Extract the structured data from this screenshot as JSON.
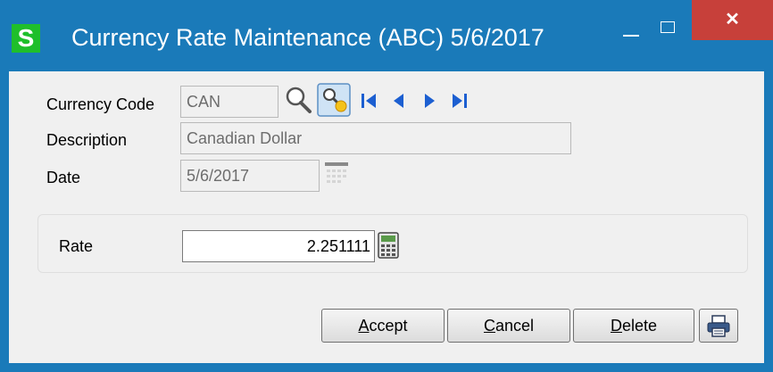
{
  "window": {
    "title": "Currency Rate Maintenance (ABC) 5/6/2017",
    "logo_letter": "S",
    "close_glyph": "✕"
  },
  "form": {
    "currency_code_label": "Currency Code",
    "currency_code_value": "CAN",
    "description_label": "Description",
    "description_value": "Canadian Dollar",
    "date_label": "Date",
    "date_value": "5/6/2017",
    "rate_label": "Rate",
    "rate_value": "2.251111"
  },
  "buttons": {
    "accept_mnemonic": "A",
    "accept_rest": "ccept",
    "cancel_mnemonic": "C",
    "cancel_rest": "ancel",
    "delete_mnemonic": "D",
    "delete_rest": "elete"
  },
  "icons": {
    "lookup": "magnifier-icon",
    "lookup_wizard": "lookup-wizard-icon",
    "first": "first-record-icon",
    "previous": "previous-record-icon",
    "next": "next-record-icon",
    "last": "last-record-icon",
    "calendar": "calendar-icon",
    "calculator": "calculator-icon",
    "print": "printer-icon"
  },
  "colors": {
    "titlebar": "#1a7ab9",
    "logo_green": "#1fbf2b",
    "close_red": "#c7403a",
    "nav_blue": "#1c5fd1"
  }
}
